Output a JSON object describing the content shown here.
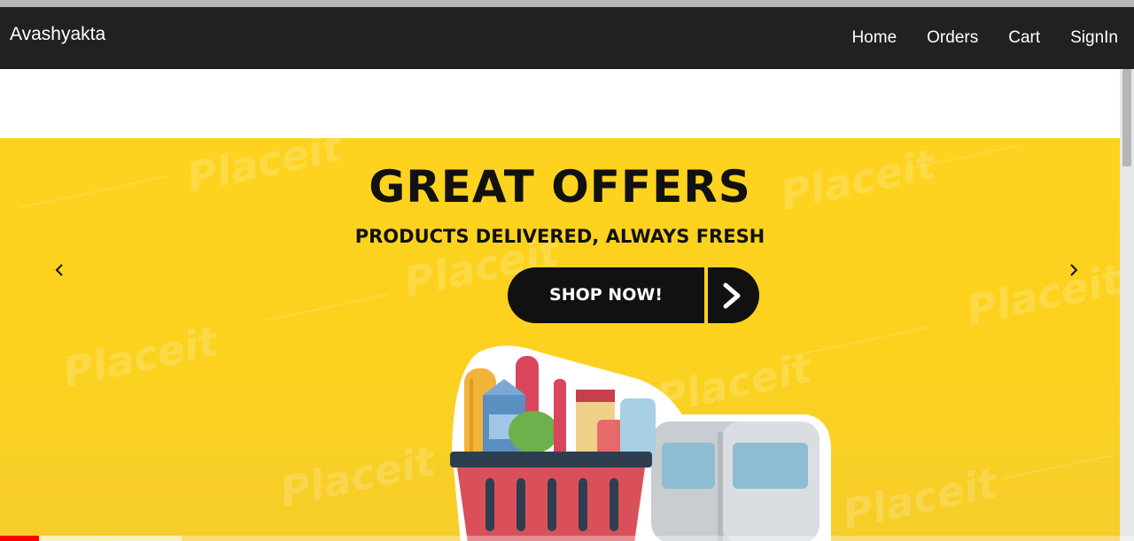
{
  "navbar": {
    "brand": "Avashyakta",
    "links": [
      "Home",
      "Orders",
      "Cart",
      "SignIn"
    ]
  },
  "banner": {
    "headline": "GREAT OFFERS",
    "subline": "PRODUCTS DELIVERED, ALWAYS FRESH",
    "cta_label": "SHOP NOW!",
    "watermark": "Placeit",
    "background_color": "#fdd31f",
    "prev_icon": "chevron-left-icon",
    "next_icon": "chevron-right-icon"
  },
  "video_progress": {
    "played_fraction": 0.034,
    "buffered_fraction": 0.16,
    "played_color": "#ff0000"
  }
}
